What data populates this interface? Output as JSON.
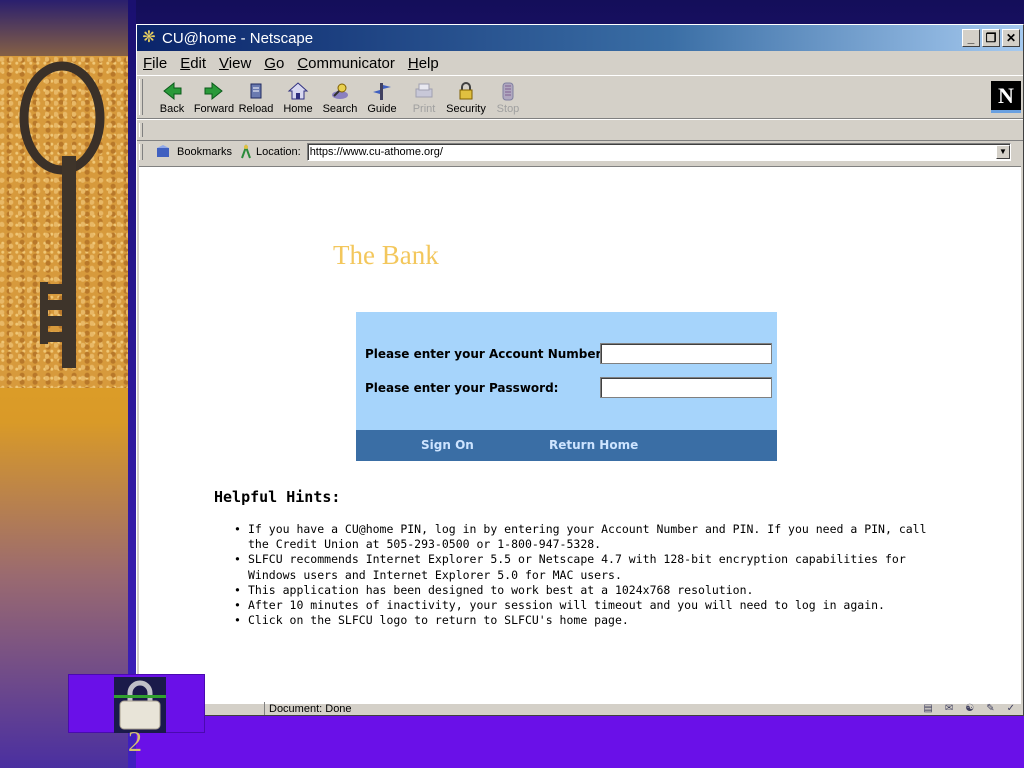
{
  "window": {
    "title": "CU@home - Netscape",
    "controls": [
      "_",
      "❐",
      "✕"
    ]
  },
  "menu": [
    {
      "key": "F",
      "rest": "ile"
    },
    {
      "key": "E",
      "rest": "dit"
    },
    {
      "key": "V",
      "rest": "iew"
    },
    {
      "key": "G",
      "rest": "o"
    },
    {
      "key": "C",
      "rest": "ommunicator"
    },
    {
      "key": "H",
      "rest": "elp"
    }
  ],
  "toolbar": {
    "back": "Back",
    "forward": "Forward",
    "reload": "Reload",
    "home": "Home",
    "search": "Search",
    "guide": "Guide",
    "print": "Print",
    "security": "Security",
    "stop": "Stop",
    "logo": "N"
  },
  "location": {
    "bookmarks": "Bookmarks",
    "label": "Location:",
    "url": "https://www.cu-athome.org/"
  },
  "page": {
    "title": "The Bank",
    "account_label": "Please enter your Account Number:",
    "password_label": "Please enter your Password:",
    "sign_on": "Sign On",
    "return_home": "Return Home",
    "hints_title": "Helpful Hints:",
    "hints": [
      "If you have a CU@home PIN, log in by entering your Account Number and PIN.  If you need a PIN, call the Credit Union at 505-293-0500 or 1-800-947-5328.",
      "SLFCU recommends Internet Explorer 5.5 or Netscape 4.7 with 128-bit encryption capabilities for Windows users and Internet Explorer 5.0 for MAC users.",
      "This application has been designed to work best at a 1024x768 resolution.",
      "After 10 minutes of inactivity, your session will timeout and you will need to log in again.",
      "Click on the SLFCU logo to return to SLFCU's home page."
    ]
  },
  "status": {
    "text": "Document: Done"
  },
  "slide": {
    "page_number": "2"
  },
  "colors": {
    "title_gold": "#f3c75c",
    "login_bg": "#a6d4fb",
    "login_bar": "#3a6ea5",
    "slide_purple": "#6a10e8"
  }
}
